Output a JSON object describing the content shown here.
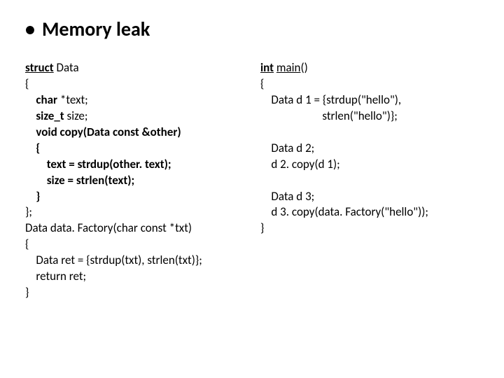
{
  "title": "Memory leak",
  "bullet": "•",
  "left": {
    "l01a": "struct",
    "l01b": "Data",
    "l02": "{",
    "l03a": "    char",
    "l03b": " *text;",
    "l04a": "    size_t",
    "l04b": " size;",
    "l05": "    void copy(Data const &other)",
    "l06": "    {",
    "l07": "        text = strdup(other. text);",
    "l08": "        size = strlen(text);",
    "l09": "    }",
    "l10": "};",
    "l11a": "Data ",
    "l11b": "data. Factory",
    "l11c": "(char const *txt)",
    "l12": "{",
    "l13": "    Data ret = {strdup(txt), strlen(txt)};",
    "l14": "    return ret;",
    "l15": "}"
  },
  "right": {
    "l01a": "int",
    "l01b": " ",
    "l01c": "main",
    "l01d": "()",
    "l02": "{",
    "l03": "    Data d 1 = {strdup(\"hello\"),",
    "l04": "                       strlen(\"hello\")};",
    "l05blank": "",
    "l06": "    Data d 2;",
    "l07": "    d 2. copy(d 1);",
    "l08blank": "",
    "l09": "    Data d 3;",
    "l10": "    d 3. copy(data. Factory(\"hello\"));",
    "l11": "}"
  }
}
